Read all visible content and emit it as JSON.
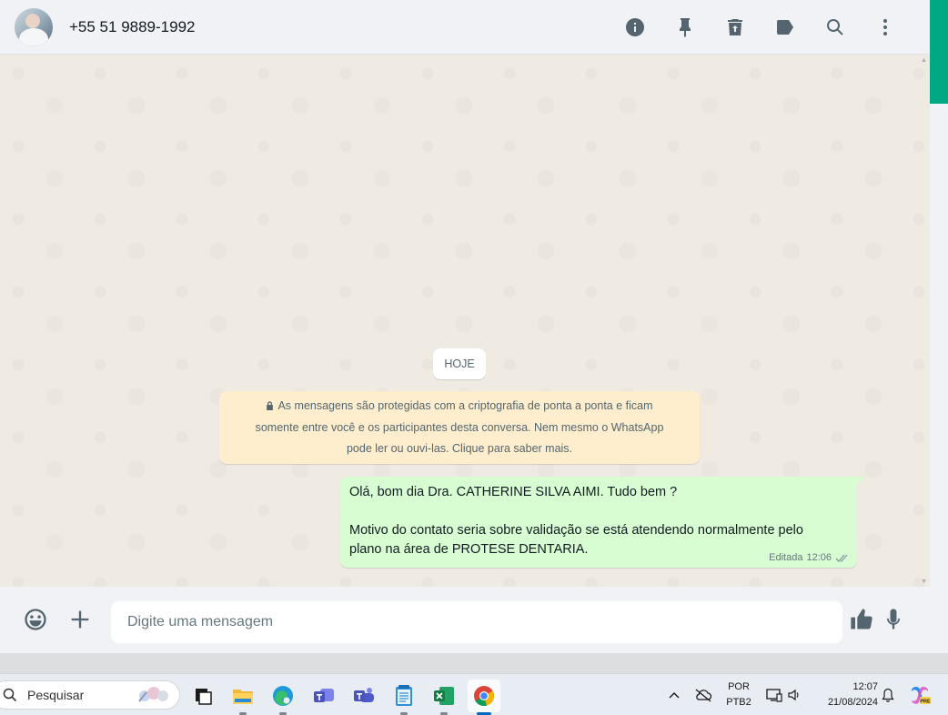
{
  "header": {
    "contact_name": "+55 51 9889-1992",
    "icons": [
      "info-icon",
      "pin-icon",
      "delete-icon",
      "label-icon",
      "search-icon",
      "menu-icon"
    ]
  },
  "chat": {
    "date_chip": "HOJE",
    "encryption_notice": {
      "line1": "As mensagens são protegidas com a criptografia de ponta a ponta e ficam",
      "line2": "somente entre você e os participantes desta conversa. Nem mesmo o WhatsApp",
      "line3": "pode ler ou ouvi-las. Clique para saber mais."
    },
    "message": {
      "line1": "Olá, bom dia Dra. CATHERINE SILVA AIMI. Tudo bem ?",
      "line2": "Motivo do contato seria sobre validação se está atendendo normalmente pelo",
      "line3": "plano na área de  PROTESE DENTARIA.",
      "edited_label": "Editada",
      "time": "12:06",
      "status": "read"
    }
  },
  "compose": {
    "placeholder": "Digite uma mensagem"
  },
  "taskbar": {
    "search_label": "Pesquisar",
    "apps": [
      "task-view",
      "file-explorer",
      "edge",
      "teams-classic",
      "teams",
      "notepad",
      "excel",
      "chrome"
    ],
    "active_app": "chrome",
    "language_line1": "POR",
    "language_line2": "PTB2",
    "time": "12:07",
    "date": "21/08/2024"
  },
  "colors": {
    "accent_green": "#00a884",
    "outgoing_bubble": "#d9fdd3",
    "notice_bg": "#ffeecd",
    "chat_bg": "#efeae2",
    "read_ticks": "#53bdeb"
  }
}
